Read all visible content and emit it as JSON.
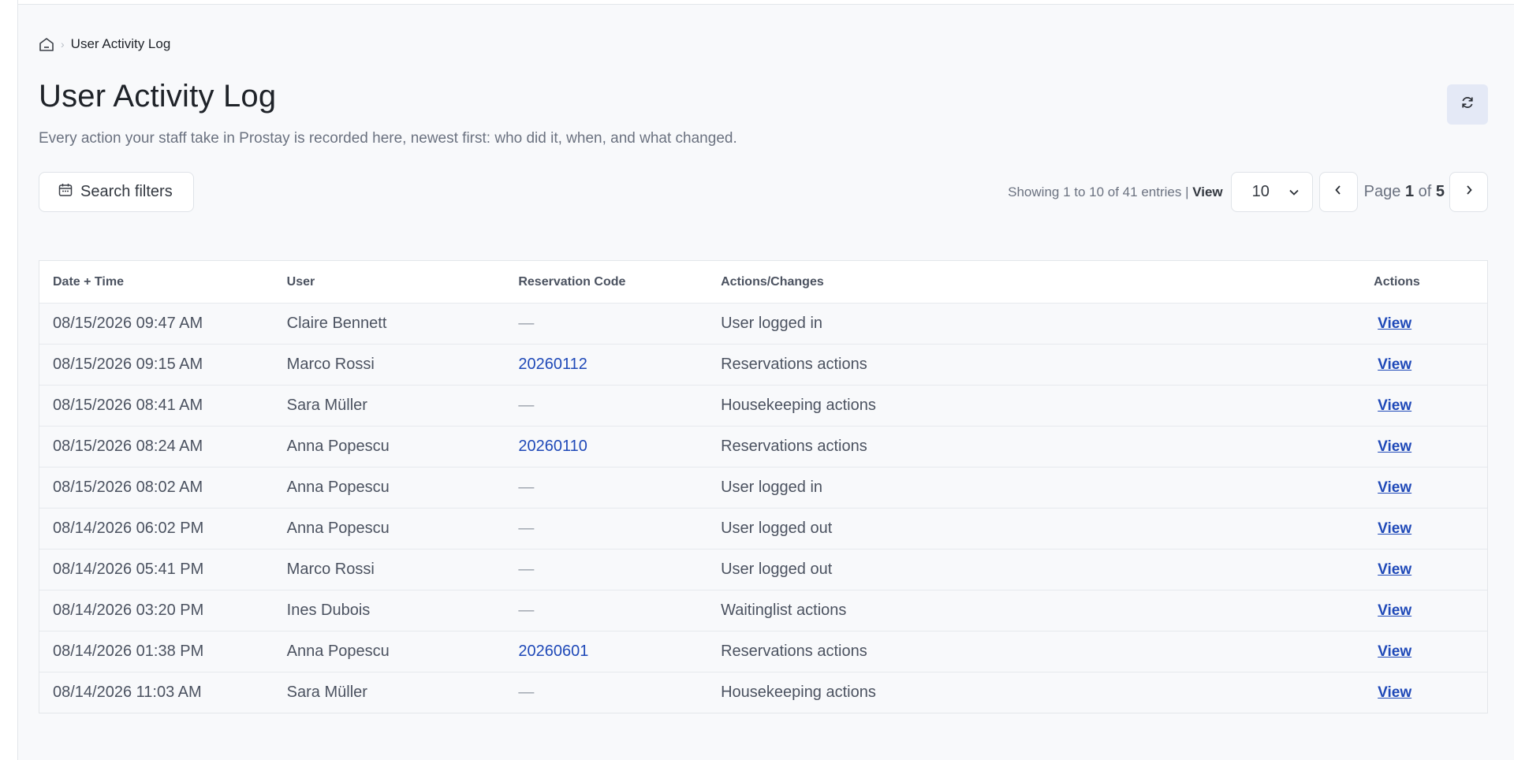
{
  "breadcrumb": {
    "current": "User Activity Log"
  },
  "header": {
    "title": "User Activity Log",
    "subtitle": "Every action your staff take in Prostay is recorded here, newest first: who did it, when, and what changed."
  },
  "toolbar": {
    "filters_label": "Search filters",
    "showing_text": "Showing 1 to 10 of 41 entries |",
    "view_label": "View",
    "page_size": "10",
    "page_word": "Page",
    "page_current": "1",
    "of_word": "of",
    "page_total": "5"
  },
  "table": {
    "columns": [
      "Date + Time",
      "User",
      "Reservation Code",
      "Actions/Changes",
      "Actions"
    ],
    "rows": [
      {
        "datetime": "08/15/2026 09:47 AM",
        "user": "Claire Bennett",
        "code": "—",
        "action": "User logged in",
        "link": "View"
      },
      {
        "datetime": "08/15/2026 09:15 AM",
        "user": "Marco Rossi",
        "code": "20260112",
        "action": "Reservations actions",
        "link": "View"
      },
      {
        "datetime": "08/15/2026 08:41 AM",
        "user": "Sara Müller",
        "code": "—",
        "action": "Housekeeping actions",
        "link": "View"
      },
      {
        "datetime": "08/15/2026 08:24 AM",
        "user": "Anna Popescu",
        "code": "20260110",
        "action": "Reservations actions",
        "link": "View"
      },
      {
        "datetime": "08/15/2026 08:02 AM",
        "user": "Anna Popescu",
        "code": "—",
        "action": "User logged in",
        "link": "View"
      },
      {
        "datetime": "08/14/2026 06:02 PM",
        "user": "Anna Popescu",
        "code": "—",
        "action": "User logged out",
        "link": "View"
      },
      {
        "datetime": "08/14/2026 05:41 PM",
        "user": "Marco Rossi",
        "code": "—",
        "action": "User logged out",
        "link": "View"
      },
      {
        "datetime": "08/14/2026 03:20 PM",
        "user": "Ines Dubois",
        "code": "—",
        "action": "Waitinglist actions",
        "link": "View"
      },
      {
        "datetime": "08/14/2026 01:38 PM",
        "user": "Anna Popescu",
        "code": "20260601",
        "action": "Reservations actions",
        "link": "View"
      },
      {
        "datetime": "08/14/2026 11:03 AM",
        "user": "Sara Müller",
        "code": "—",
        "action": "Housekeeping actions",
        "link": "View"
      }
    ]
  },
  "icons": {
    "home": "home-icon",
    "refresh": "refresh-icon",
    "calendar": "calendar-icon",
    "chevron_down": "chevron-down-icon",
    "prev": "chevron-left-icon",
    "next": "chevron-right-icon"
  },
  "colors": {
    "link": "#1f49b8",
    "refresh_bg": "#e4e9f6"
  }
}
